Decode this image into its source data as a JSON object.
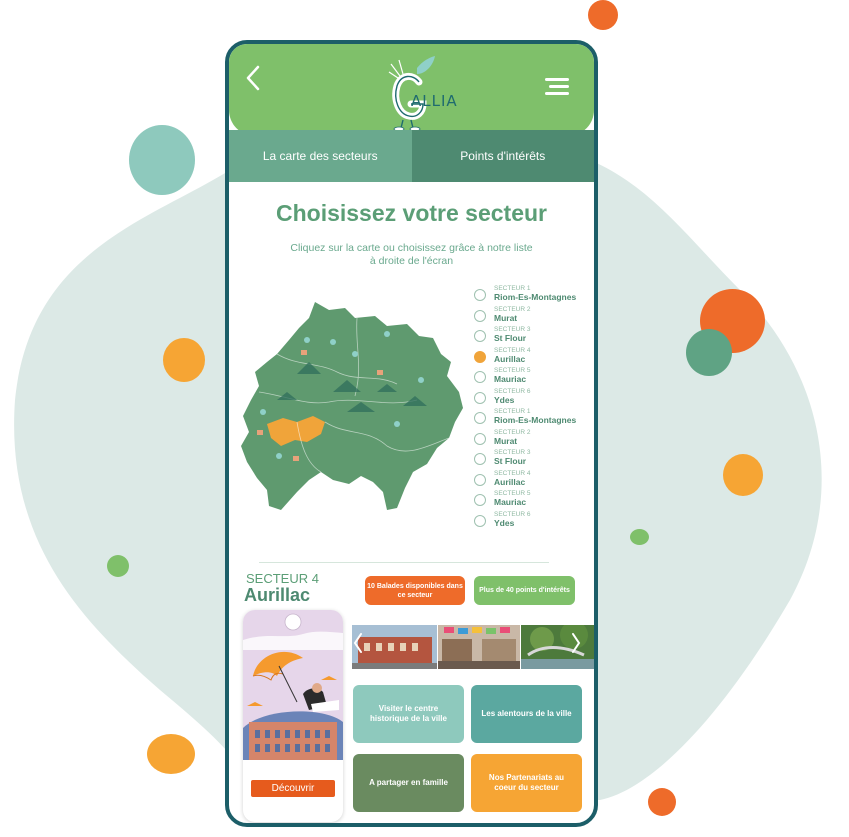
{
  "app": {
    "logo_text": "ALLIA"
  },
  "tabs": [
    {
      "label": "La carte des secteurs",
      "active": true
    },
    {
      "label": "Points d'intérêts",
      "active": false
    }
  ],
  "main": {
    "title": "Choisissez votre secteur",
    "subtitle_line1": "Cliquez sur la carte ou choisissez grâce à notre liste",
    "subtitle_line2": "à droite de l'écran"
  },
  "sectors": [
    {
      "small": "SECTEUR 1",
      "name": "Riom-Es-Montagnes",
      "selected": false
    },
    {
      "small": "SECTEUR 2",
      "name": "Murat",
      "selected": false
    },
    {
      "small": "SECTEUR 3",
      "name": "St Flour",
      "selected": false
    },
    {
      "small": "SECTEUR 4",
      "name": "Aurillac",
      "selected": true
    },
    {
      "small": "SECTEUR 5",
      "name": "Mauriac",
      "selected": false
    },
    {
      "small": "SECTEUR 6",
      "name": "Ydes",
      "selected": false
    },
    {
      "small": "SECTEUR 1",
      "name": "Riom-Es-Montagnes",
      "selected": false
    },
    {
      "small": "SECTEUR 2",
      "name": "Murat",
      "selected": false
    },
    {
      "small": "SECTEUR 3",
      "name": "St Flour",
      "selected": false
    },
    {
      "small": "SECTEUR 4",
      "name": "Aurillac",
      "selected": false
    },
    {
      "small": "SECTEUR 5",
      "name": "Mauriac",
      "selected": false
    },
    {
      "small": "SECTEUR 6",
      "name": "Ydes",
      "selected": false
    }
  ],
  "selected": {
    "small": "SECTEUR 4",
    "name": "Aurillac",
    "balades": "10 Balades disponibles dans ce secteur",
    "points": "Plus de 40 points d'intérêts",
    "discover_label": "Découvrir"
  },
  "tiles": [
    {
      "label": "Visiter le centre historique de la ville"
    },
    {
      "label": "Les alentours de la ville"
    },
    {
      "label": "A partager en famille"
    },
    {
      "label": "Nos Partenariats au coeur du secteur"
    }
  ],
  "colors": {
    "header_green": "#7fc06a",
    "title_green": "#5b9e76",
    "orange": "#ee6b2a",
    "selected_yellow": "#f0a43a",
    "frame": "#1c5e68"
  },
  "icons": {
    "back": "chevron-left-icon",
    "menu": "hamburger-menu-icon",
    "prev": "chevron-left-icon",
    "next": "chevron-right-icon"
  }
}
